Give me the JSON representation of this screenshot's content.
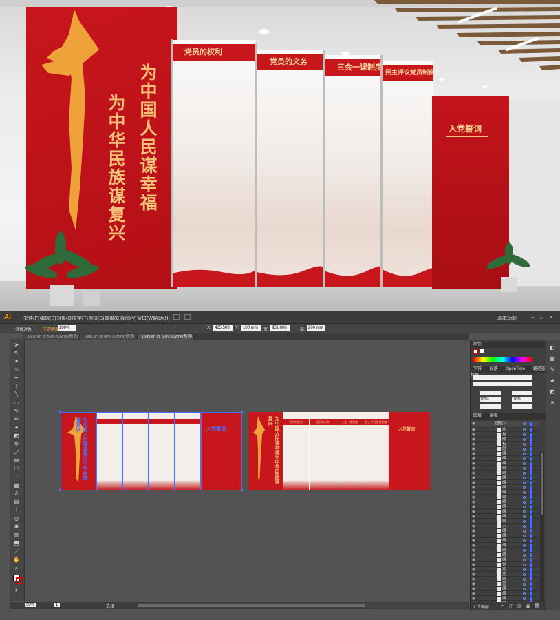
{
  "render": {
    "slogan_right": "为中国人民谋幸福",
    "slogan_left": "为中华民族谋复兴",
    "boards": [
      {
        "title": "党员的权利"
      },
      {
        "title": "党员的义务"
      },
      {
        "title": "三会一课制度"
      },
      {
        "title": "民主评议党员制度"
      }
    ],
    "pledge_title": "入党誓词"
  },
  "app": {
    "logo": "Ai",
    "menus": [
      "文件(F)",
      "编辑(E)",
      "对象(O)",
      "文字(T)",
      "选择(S)",
      "效果(C)",
      "视图(V)",
      "窗口(W)",
      "帮助(H)"
    ],
    "workspace": "基本功能",
    "control_bar": {
      "selection_label": "混合对象",
      "opacity_label": "不透明度",
      "opacity_value": "100%",
      "x_label": "X:",
      "x_value": "465.503",
      "y_label": "Y:",
      "y_value": "100 mm",
      "w_label": "宽:",
      "w_value": "951.006",
      "h_label": "高:",
      "h_value": "200 mm"
    },
    "tabs": [
      {
        "label": "1607.ai* @ 50% (CMYK/预览)",
        "active": false
      },
      {
        "label": "1606.ai* @ 50% (CMYK/预览)",
        "active": false
      },
      {
        "label": "1609.ai* @ 50% (CMYK/预览)",
        "active": true
      }
    ],
    "canvas": {
      "board_titles": [
        "党员的权利",
        "党员的义务",
        "三会一课制度",
        "民主评议党员制度"
      ],
      "pledge_title": "入党誓词",
      "slogan": "为中国人民谋幸福为中华民族谋复兴"
    },
    "status": {
      "zoom": "50%",
      "page": "1",
      "tool_hint": "选择"
    },
    "panels": {
      "color_tab": "颜色",
      "char_tabs": [
        "字符",
        "段落",
        "OpenType",
        "路径查找器"
      ],
      "char_values": [
        "100%",
        "100%"
      ],
      "layers_tabs": [
        "图层",
        "画板"
      ],
      "layer_title": "图层 1",
      "layer_count": "1 个图层",
      "layers": [
        "永",
        "党",
        "你",
        "权",
        "层",
        "编",
        "编",
        "编",
        "编",
        "编",
        "编",
        "编",
        "编",
        "编",
        "编",
        "编",
        "编",
        "编",
        "编",
        "编",
        "入",
        "编",
        "编",
        "编",
        "编",
        "编",
        "编",
        "编",
        "党",
        "宽",
        "宽",
        "编",
        "宽",
        "编",
        "编",
        "编",
        "编"
      ]
    },
    "colors": {
      "party_red": "#c8161d",
      "gold": "#f3c277",
      "ui_bg": "#535353",
      "selection_blue": "#4b6fff"
    }
  }
}
